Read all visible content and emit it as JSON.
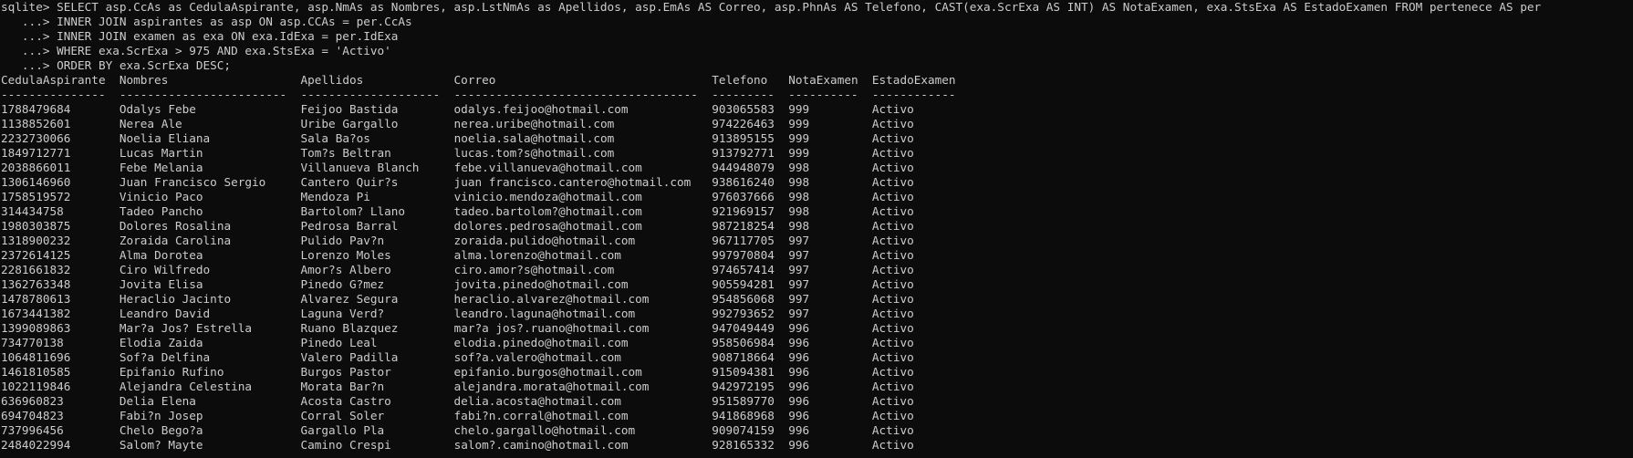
{
  "terminal": {
    "background": "#0c0c0c",
    "foreground": "#cccccc",
    "prompt": "sqlite> ",
    "continuation": "   ...> ",
    "query_lines": [
      "SELECT asp.CcAs as CedulaAspirante, asp.NmAs as Nombres, asp.LstNmAs as Apellidos, asp.EmAs AS Correo, asp.PhnAs AS Telefono, CAST(exa.ScrExa AS INT) AS NotaExamen, exa.StsExa AS EstadoExamen FROM pertenece AS per",
      "INNER JOIN aspirantes as asp ON asp.CCAs = per.CcAs",
      "INNER JOIN examen as exa ON exa.IdExa = per.IdExa",
      "WHERE exa.ScrExa > 975 AND exa.StsExa = 'Activo'",
      "ORDER BY exa.ScrExa DESC;"
    ],
    "columns": [
      {
        "name": "CedulaAspirante",
        "width": 15
      },
      {
        "name": "Nombres",
        "width": 24
      },
      {
        "name": "Apellidos",
        "width": 20
      },
      {
        "name": "Correo",
        "width": 35
      },
      {
        "name": "Telefono",
        "width": 9
      },
      {
        "name": "NotaExamen",
        "width": 10
      },
      {
        "name": "EstadoExamen",
        "width": 12
      }
    ],
    "rows": [
      [
        "1788479684",
        "Odalys Febe",
        "Feijoo Bastida",
        "odalys.feijoo@hotmail.com",
        "903065583",
        "999",
        "Activo"
      ],
      [
        "1138852601",
        "Nerea Ale",
        "Uribe Gargallo",
        "nerea.uribe@hotmail.com",
        "974226463",
        "999",
        "Activo"
      ],
      [
        "2232730066",
        "Noelia Eliana",
        "Sala Ba?os",
        "noelia.sala@hotmail.com",
        "913895155",
        "999",
        "Activo"
      ],
      [
        "1849712771",
        "Lucas Martin",
        "Tom?s Beltran",
        "lucas.tom?s@hotmail.com",
        "913792771",
        "999",
        "Activo"
      ],
      [
        "2038866011",
        "Febe Melania",
        "Villanueva Blanch",
        "febe.villanueva@hotmail.com",
        "944948079",
        "998",
        "Activo"
      ],
      [
        "1306146960",
        "Juan Francisco Sergio",
        "Cantero Quir?s",
        "juan francisco.cantero@hotmail.com",
        "938616240",
        "998",
        "Activo"
      ],
      [
        "1758519572",
        "Vinicio Paco",
        "Mendoza Pi",
        "vinicio.mendoza@hotmail.com",
        "976037666",
        "998",
        "Activo"
      ],
      [
        "314434758",
        "Tadeo Pancho",
        "Bartolom? Llano",
        "tadeo.bartolom?@hotmail.com",
        "921969157",
        "998",
        "Activo"
      ],
      [
        "1980303875",
        "Dolores Rosalina",
        "Pedrosa Barral",
        "dolores.pedrosa@hotmail.com",
        "987218254",
        "998",
        "Activo"
      ],
      [
        "1318900232",
        "Zoraida Carolina",
        "Pulido Pav?n",
        "zoraida.pulido@hotmail.com",
        "967117705",
        "997",
        "Activo"
      ],
      [
        "2372614125",
        "Alma Dorotea",
        "Lorenzo Moles",
        "alma.lorenzo@hotmail.com",
        "997970804",
        "997",
        "Activo"
      ],
      [
        "2281661832",
        "Ciro Wilfredo",
        "Amor?s Albero",
        "ciro.amor?s@hotmail.com",
        "974657414",
        "997",
        "Activo"
      ],
      [
        "1362763348",
        "Jovita Elisa",
        "Pinedo G?mez",
        "jovita.pinedo@hotmail.com",
        "905594281",
        "997",
        "Activo"
      ],
      [
        "1478780613",
        "Heraclio Jacinto",
        "Alvarez Segura",
        "heraclio.alvarez@hotmail.com",
        "954856068",
        "997",
        "Activo"
      ],
      [
        "1673441382",
        "Leandro David",
        "Laguna Verd?",
        "leandro.laguna@hotmail.com",
        "992793652",
        "997",
        "Activo"
      ],
      [
        "1399089863",
        "Mar?a Jos? Estrella",
        "Ruano Blazquez",
        "mar?a jos?.ruano@hotmail.com",
        "947049449",
        "996",
        "Activo"
      ],
      [
        "734770138",
        "Elodia Zaida",
        "Pinedo Leal",
        "elodia.pinedo@hotmail.com",
        "958506984",
        "996",
        "Activo"
      ],
      [
        "1064811696",
        "Sof?a Delfina",
        "Valero Padilla",
        "sof?a.valero@hotmail.com",
        "908718664",
        "996",
        "Activo"
      ],
      [
        "1461810585",
        "Epifanio Rufino",
        "Burgos Pastor",
        "epifanio.burgos@hotmail.com",
        "915094381",
        "996",
        "Activo"
      ],
      [
        "1022119846",
        "Alejandra Celestina",
        "Morata Bar?n",
        "alejandra.morata@hotmail.com",
        "942972195",
        "996",
        "Activo"
      ],
      [
        "636960823",
        "Delia Elena",
        "Acosta Castro",
        "delia.acosta@hotmail.com",
        "951589770",
        "996",
        "Activo"
      ],
      [
        "694704823",
        "Fabi?n Josep",
        "Corral Soler",
        "fabi?n.corral@hotmail.com",
        "941868968",
        "996",
        "Activo"
      ],
      [
        "737996456",
        "Chelo Bego?a",
        "Gargallo Pla",
        "chelo.gargallo@hotmail.com",
        "909074159",
        "996",
        "Activo"
      ],
      [
        "2484022994",
        "Salom? Mayte",
        "Camino Crespi",
        "salom?.camino@hotmail.com",
        "928165332",
        "996",
        "Activo"
      ]
    ]
  }
}
